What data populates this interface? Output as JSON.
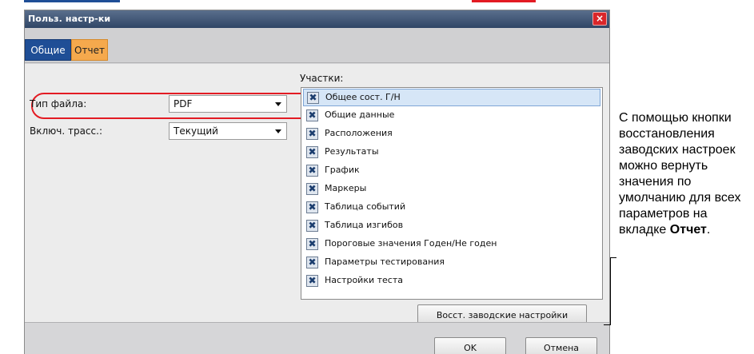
{
  "dialog": {
    "title": "Польз. настр-ки",
    "close_icon": "close-icon",
    "close_glyph": "×"
  },
  "tabs": [
    {
      "label": "Общие"
    },
    {
      "label": "Отчет"
    }
  ],
  "general": {
    "file_type_label": "Тип файла:",
    "file_type_value": "PDF",
    "include_traces_label": "Включ. трасс.:",
    "include_traces_value": "Текущий",
    "dropdown_icon": "chevron-down-icon"
  },
  "sections": {
    "label": "Участки:",
    "checkbox_icon": "checkbox-checked-icon",
    "check_glyph": "✖",
    "items": [
      "Общее сост. Г/Н",
      "Общие данные",
      "Расположения",
      "Результаты",
      "График",
      "Маркеры",
      "Таблица событий",
      "Таблица изгибов",
      "Пороговые значения Годен/Не годен",
      "Параметры тестирования",
      "Настройки теста"
    ]
  },
  "buttons": {
    "restore": "Восст. заводские настройки",
    "ok": "OK",
    "cancel": "Отмена"
  },
  "callout": {
    "text": "С помощью кнопки восстановления заводских настроек можно вернуть значения по умолчанию для всех параметров на вкладке ",
    "bold_text": "Отчет",
    "suffix": "."
  },
  "colors": {
    "tab_active": "#1f4e96",
    "tab_report": "#f5a94d",
    "highlight": "#e31b23",
    "close": "#d9262a"
  }
}
